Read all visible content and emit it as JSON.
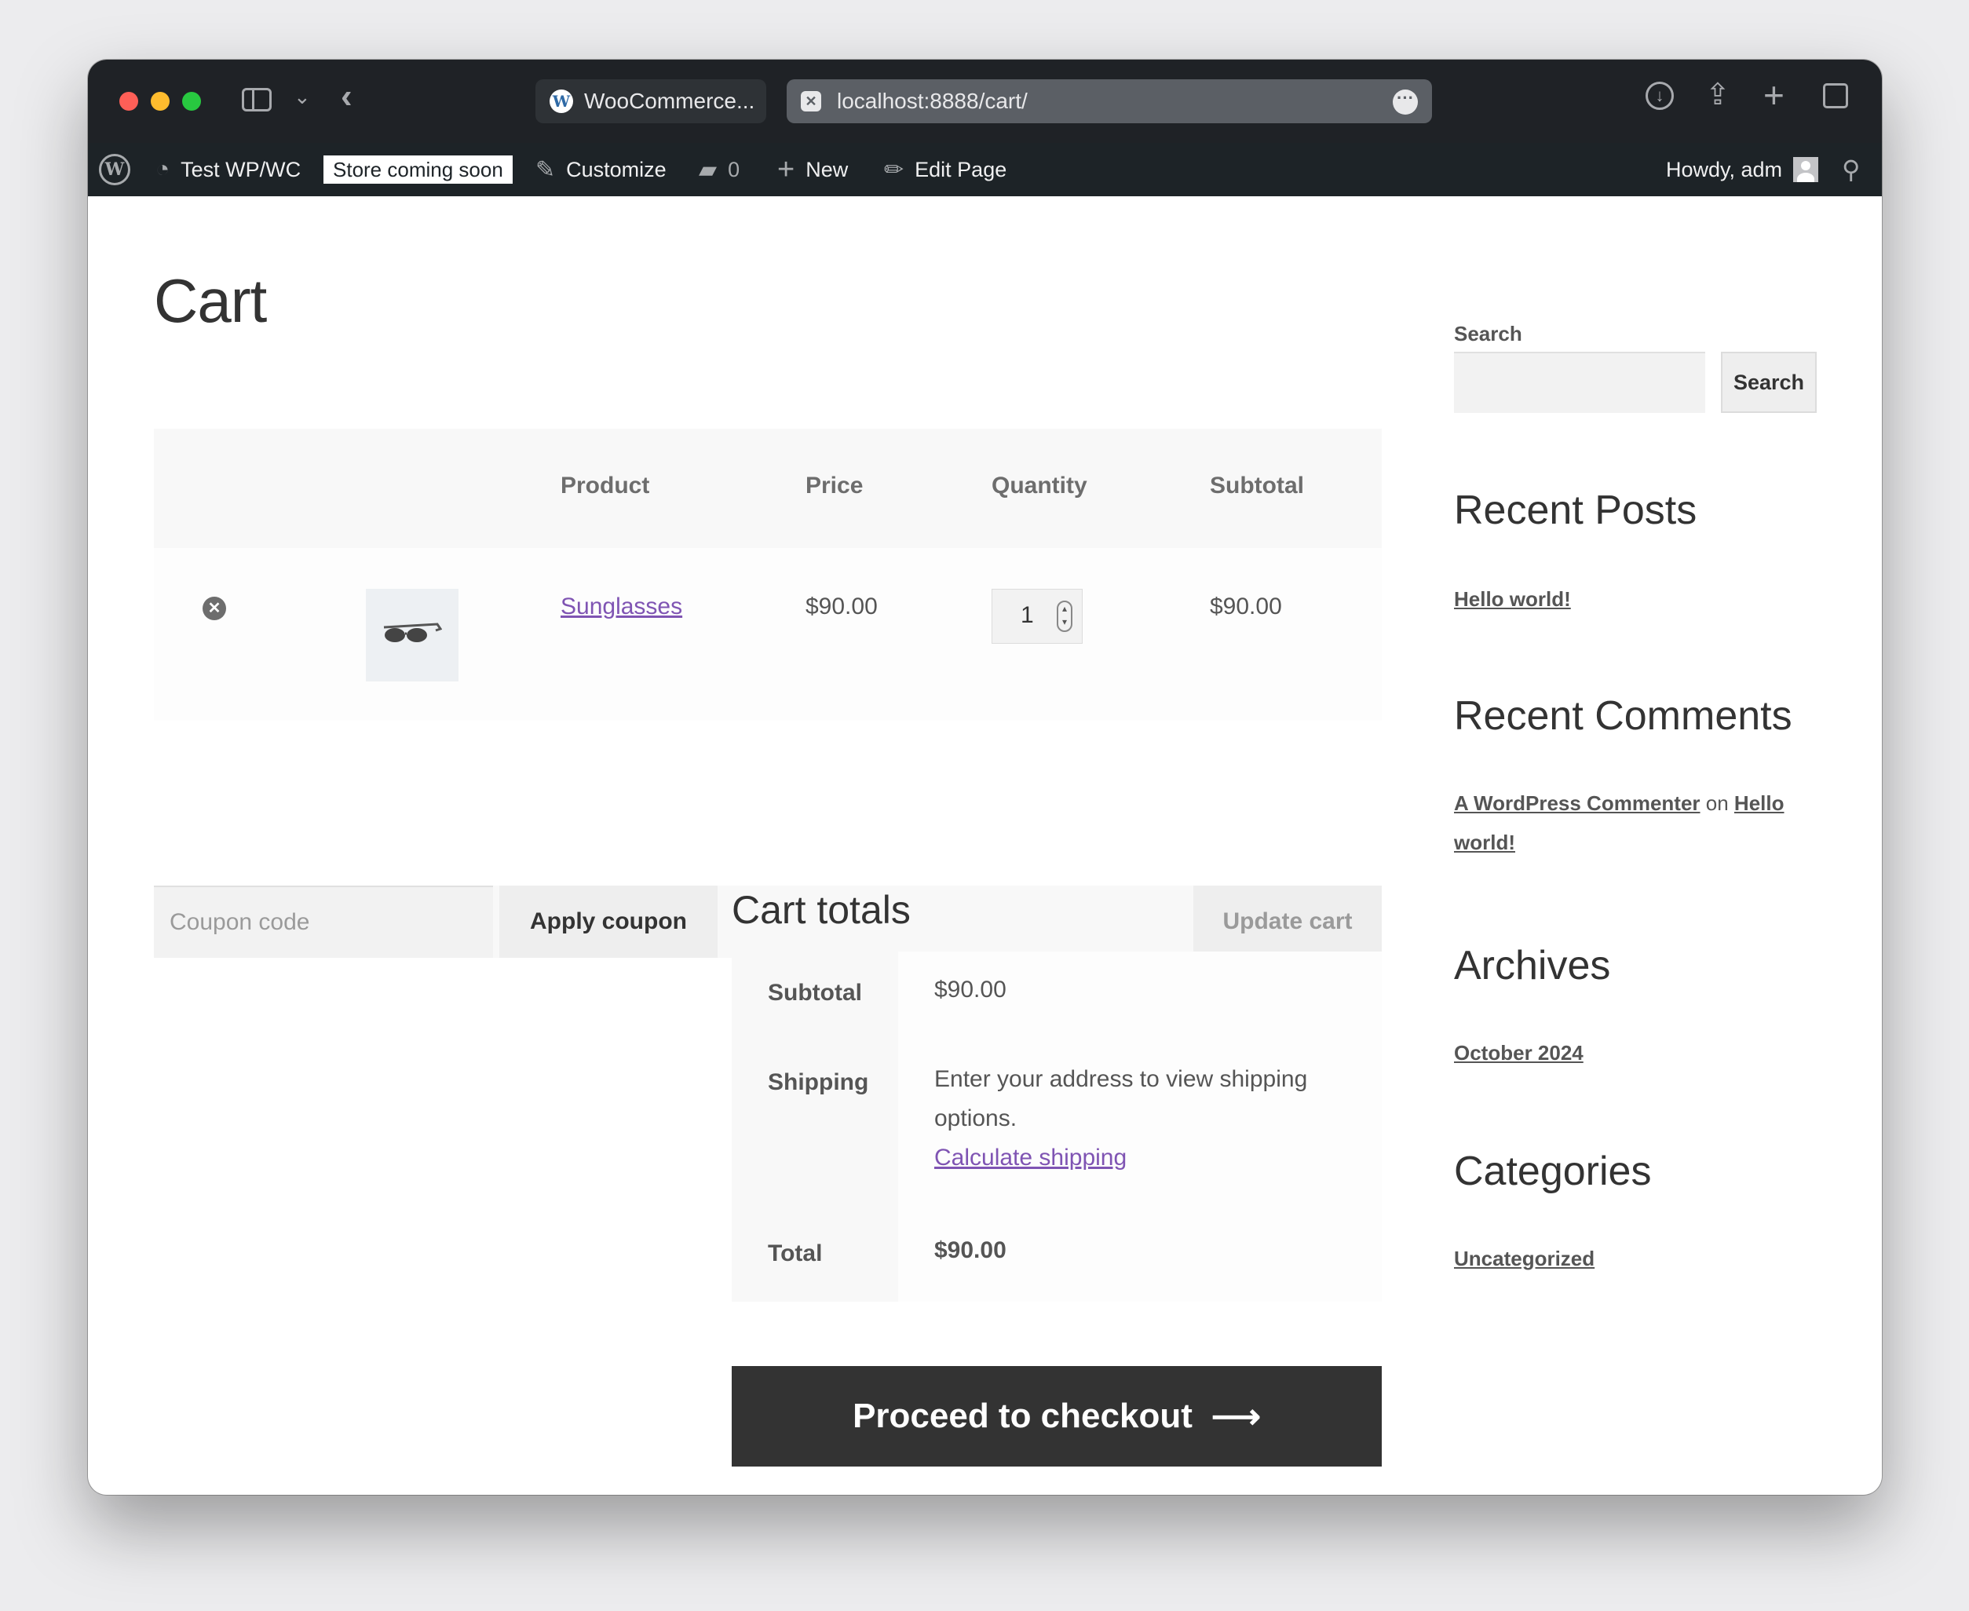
{
  "browser": {
    "tab_inactive_title": "WooCommerce...",
    "address_bar_url": "localhost:8888/cart/"
  },
  "admin_bar": {
    "site_name": "Test WP/WC",
    "store_badge": "Store coming soon",
    "customize": "Customize",
    "comments_count": "0",
    "new": "New",
    "edit_page": "Edit Page",
    "howdy": "Howdy, adm"
  },
  "page": {
    "title": "Cart"
  },
  "cart_table": {
    "headers": {
      "product": "Product",
      "price": "Price",
      "quantity": "Quantity",
      "subtotal": "Subtotal"
    },
    "items": [
      {
        "product": "Sunglasses",
        "price": "$90.00",
        "quantity": "1",
        "subtotal": "$90.00"
      }
    ]
  },
  "actions": {
    "coupon_placeholder": "Coupon code",
    "apply_coupon": "Apply coupon",
    "update_cart": "Update cart"
  },
  "totals": {
    "title": "Cart totals",
    "subtotal_label": "Subtotal",
    "subtotal_value": "$90.00",
    "shipping_label": "Shipping",
    "shipping_text": "Enter your address to view shipping options.",
    "calculate_shipping": "Calculate shipping",
    "total_label": "Total",
    "total_value": "$90.00",
    "checkout_button": "Proceed to checkout",
    "checkout_arrow": "⟶"
  },
  "sidebar": {
    "search_label": "Search",
    "search_button": "Search",
    "recent_posts_title": "Recent Posts",
    "recent_post": "Hello world!",
    "recent_comments_title": "Recent Comments",
    "comment_author": "A WordPress Commenter",
    "comment_on": "on",
    "comment_post": "Hello world!",
    "archives_title": "Archives",
    "archive_month": "October 2024",
    "categories_title": "Categories",
    "category": "Uncategorized"
  },
  "colors": {
    "link": "#7f54b3",
    "checkout_bg": "#333333",
    "admin_bar_bg": "#1d2327"
  }
}
